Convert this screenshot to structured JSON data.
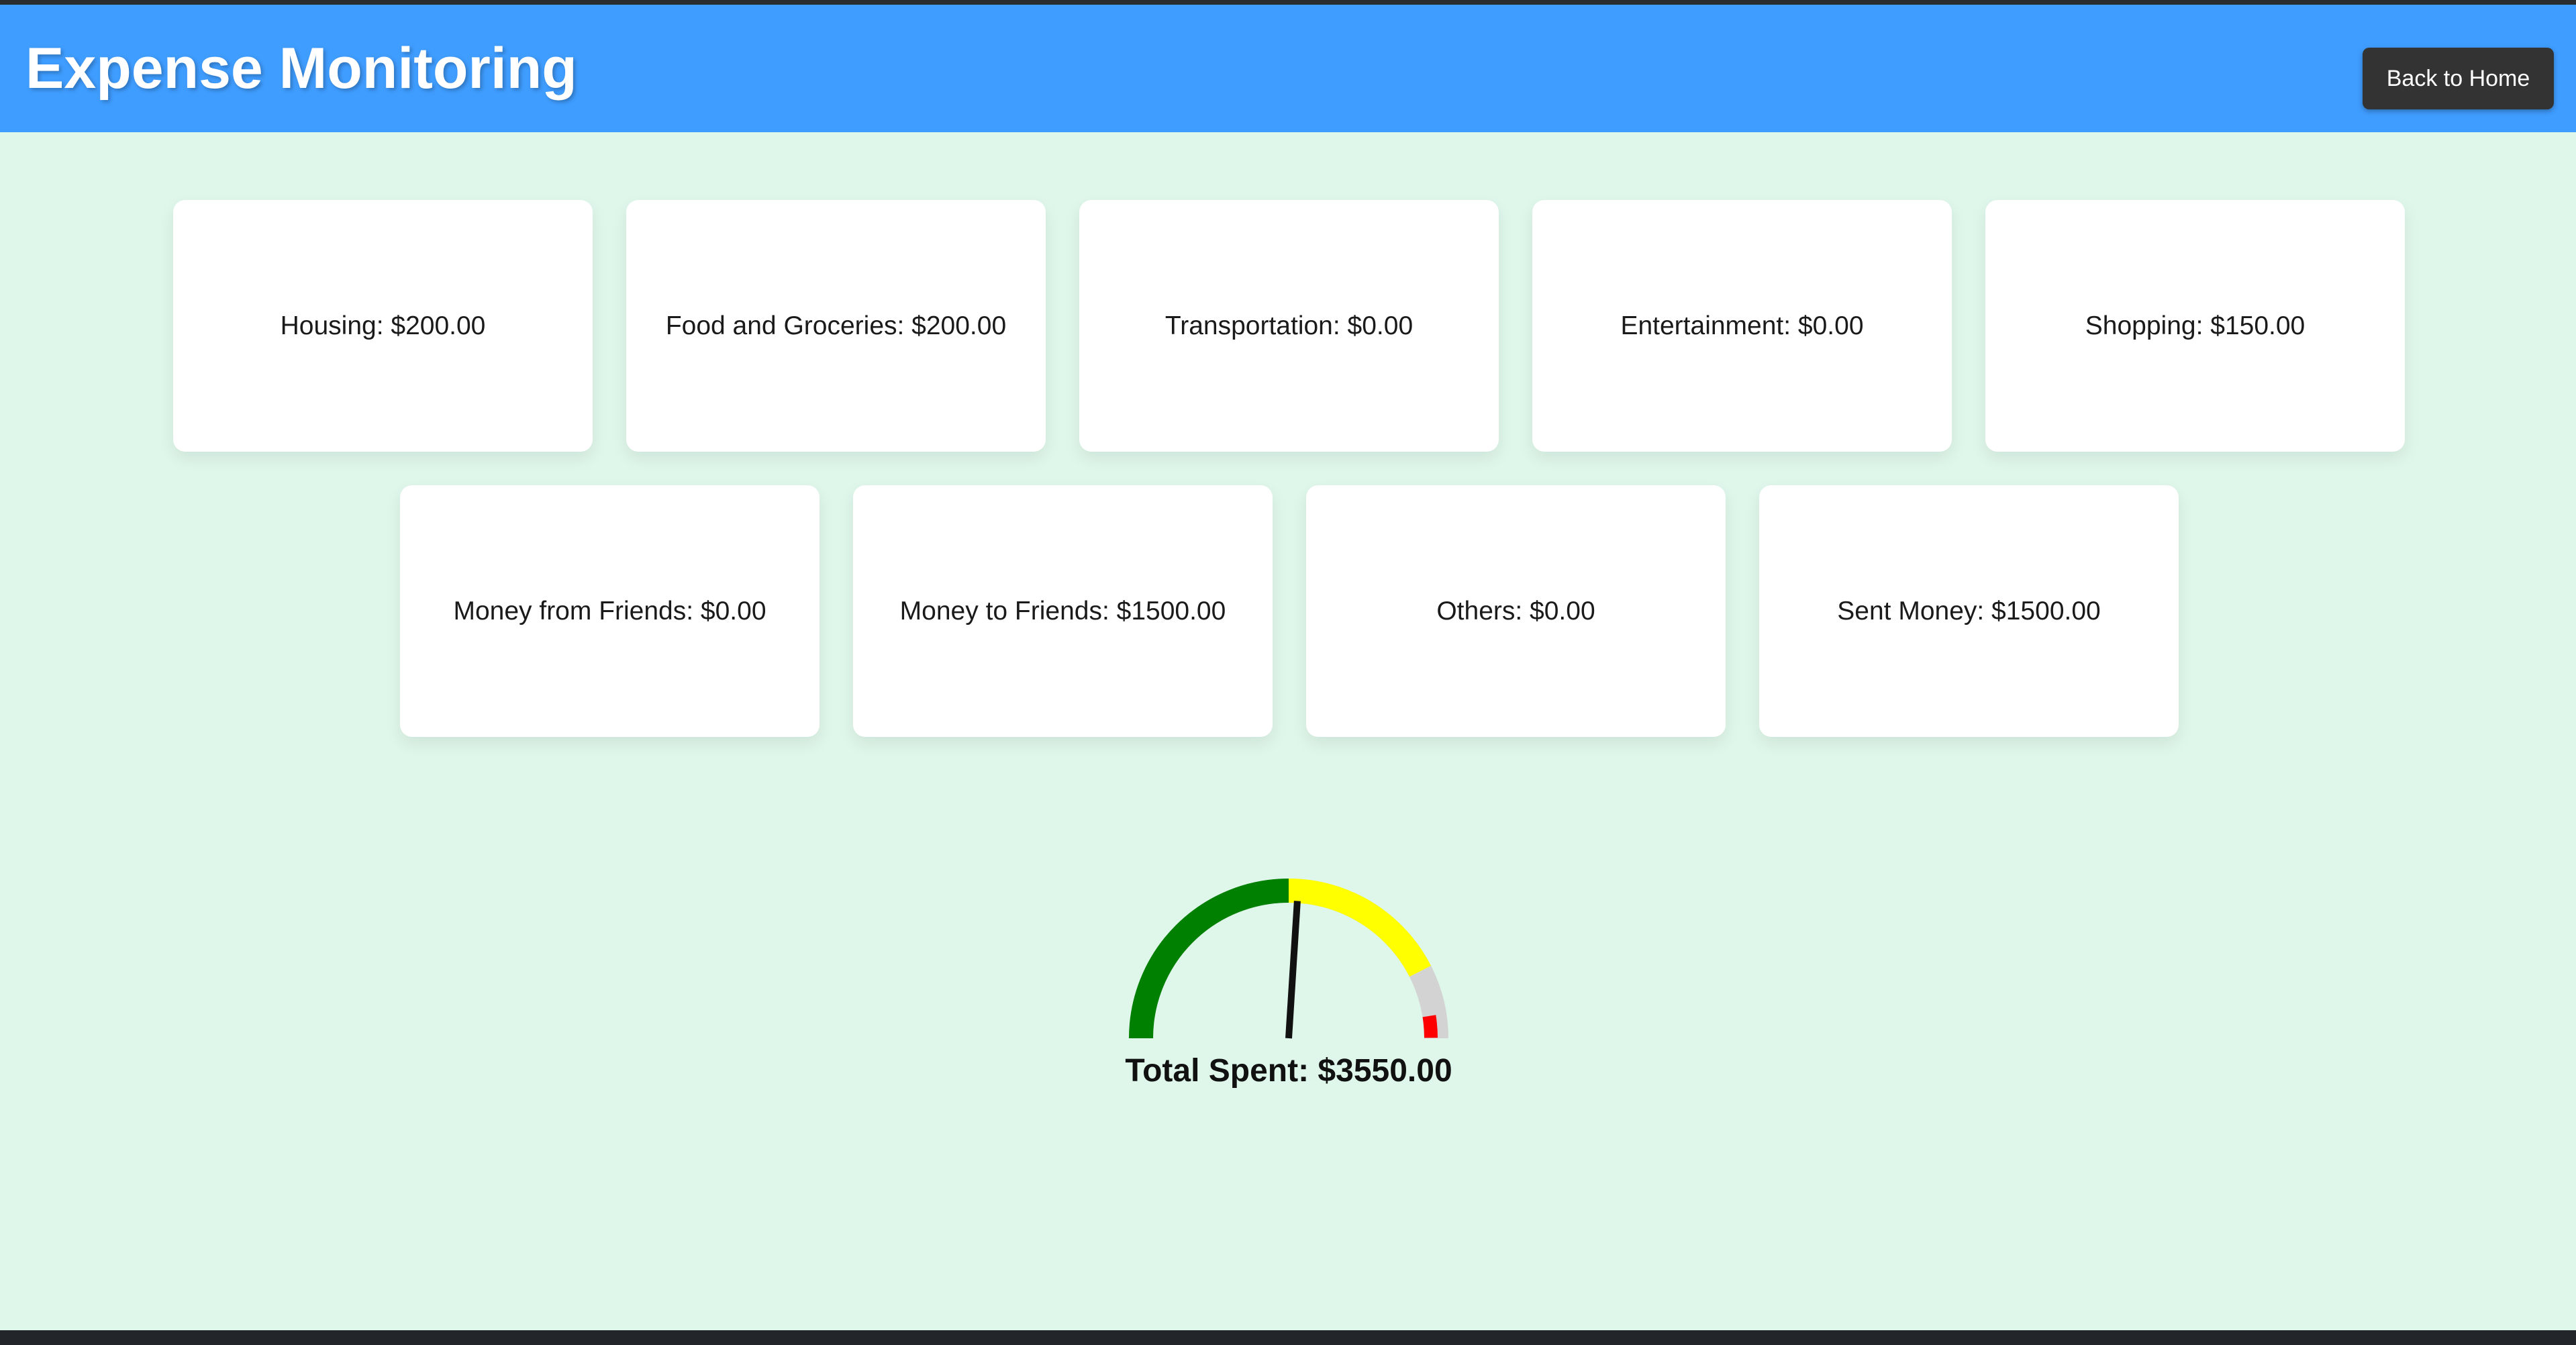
{
  "header": {
    "title": "Expense Monitoring",
    "back_label": "Back to Home"
  },
  "categories": [
    "Housing: $200.00",
    "Food and Groceries: $200.00",
    "Transportation: $0.00",
    "Entertainment: $0.00",
    "Shopping: $150.00",
    "Money from Friends: $0.00",
    "Money to Friends: $1500.00",
    "Others: $0.00",
    "Sent Money: $1500.00"
  ],
  "gauge": {
    "total_label": "Total Spent: $3550.00",
    "needle_fraction": 0.52,
    "colors": {
      "green": "#008000",
      "yellow": "#ffff00",
      "red": "#ff0000",
      "track": "#d3d3d3"
    }
  },
  "colors": {
    "header_bg": "#3f9dff",
    "page_bg": "#dff7ea",
    "button_bg": "#333333"
  }
}
